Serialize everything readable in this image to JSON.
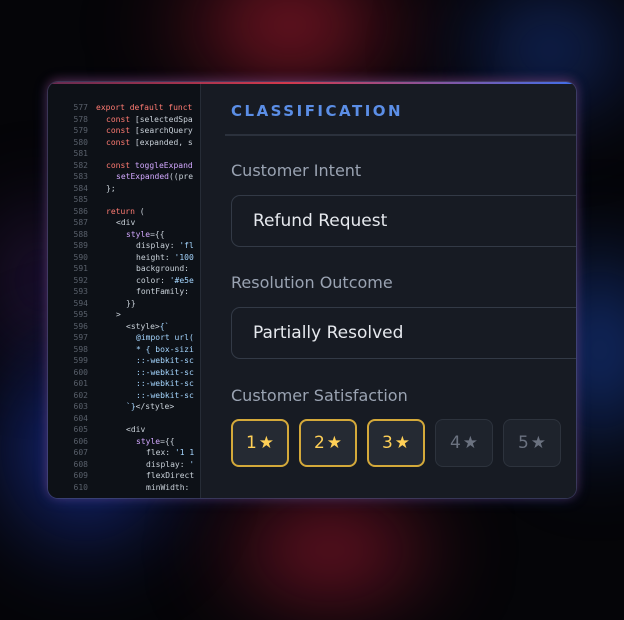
{
  "code_editor": {
    "lines": [
      {
        "n": "577",
        "indent": 0,
        "tokens": [
          {
            "t": "export default funct",
            "c": "kw"
          }
        ]
      },
      {
        "n": "578",
        "indent": 1,
        "tokens": [
          {
            "t": "const ",
            "c": "kw"
          },
          {
            "t": "[selectedSpa",
            "c": "plain"
          }
        ]
      },
      {
        "n": "579",
        "indent": 1,
        "tokens": [
          {
            "t": "const ",
            "c": "kw"
          },
          {
            "t": "[searchQuery",
            "c": "plain"
          }
        ]
      },
      {
        "n": "580",
        "indent": 1,
        "tokens": [
          {
            "t": "const ",
            "c": "kw"
          },
          {
            "t": "[expanded, s",
            "c": "plain"
          }
        ]
      },
      {
        "n": "581",
        "indent": 0,
        "tokens": []
      },
      {
        "n": "582",
        "indent": 1,
        "tokens": [
          {
            "t": "const ",
            "c": "kw"
          },
          {
            "t": "toggleExpand",
            "c": "fn"
          }
        ]
      },
      {
        "n": "583",
        "indent": 2,
        "tokens": [
          {
            "t": "setExpanded",
            "c": "fn"
          },
          {
            "t": "((pre",
            "c": "plain"
          }
        ]
      },
      {
        "n": "584",
        "indent": 1,
        "tokens": [
          {
            "t": "};",
            "c": "plain"
          }
        ]
      },
      {
        "n": "585",
        "indent": 0,
        "tokens": []
      },
      {
        "n": "586",
        "indent": 1,
        "tokens": [
          {
            "t": "return ",
            "c": "kw"
          },
          {
            "t": "(",
            "c": "plain"
          }
        ]
      },
      {
        "n": "587",
        "indent": 2,
        "tokens": [
          {
            "t": "<div",
            "c": "plain"
          }
        ]
      },
      {
        "n": "588",
        "indent": 3,
        "tokens": [
          {
            "t": "style",
            "c": "fn"
          },
          {
            "t": "={{",
            "c": "plain"
          }
        ]
      },
      {
        "n": "589",
        "indent": 4,
        "tokens": [
          {
            "t": "display: ",
            "c": "plain"
          },
          {
            "t": "'fl",
            "c": "str"
          }
        ]
      },
      {
        "n": "590",
        "indent": 4,
        "tokens": [
          {
            "t": "height: ",
            "c": "plain"
          },
          {
            "t": "'100",
            "c": "str"
          }
        ]
      },
      {
        "n": "591",
        "indent": 4,
        "tokens": [
          {
            "t": "background:",
            "c": "plain"
          }
        ]
      },
      {
        "n": "592",
        "indent": 4,
        "tokens": [
          {
            "t": "color: ",
            "c": "plain"
          },
          {
            "t": "'#e5e",
            "c": "str"
          }
        ]
      },
      {
        "n": "593",
        "indent": 4,
        "tokens": [
          {
            "t": "fontFamily:",
            "c": "plain"
          }
        ]
      },
      {
        "n": "594",
        "indent": 3,
        "tokens": [
          {
            "t": "}}",
            "c": "plain"
          }
        ]
      },
      {
        "n": "595",
        "indent": 2,
        "tokens": [
          {
            "t": ">",
            "c": "plain"
          }
        ]
      },
      {
        "n": "596",
        "indent": 3,
        "tokens": [
          {
            "t": "<style>",
            "c": "plain"
          },
          {
            "t": "{`",
            "c": "str"
          }
        ]
      },
      {
        "n": "597",
        "indent": 4,
        "tokens": [
          {
            "t": "@import url(",
            "c": "str"
          }
        ]
      },
      {
        "n": "598",
        "indent": 4,
        "tokens": [
          {
            "t": "* { box-sizi",
            "c": "str"
          }
        ]
      },
      {
        "n": "599",
        "indent": 4,
        "tokens": [
          {
            "t": "::-webkit-sc",
            "c": "str"
          }
        ]
      },
      {
        "n": "600",
        "indent": 4,
        "tokens": [
          {
            "t": "::-webkit-sc",
            "c": "str"
          }
        ]
      },
      {
        "n": "601",
        "indent": 4,
        "tokens": [
          {
            "t": "::-webkit-sc",
            "c": "str"
          }
        ]
      },
      {
        "n": "602",
        "indent": 4,
        "tokens": [
          {
            "t": "::-webkit-sc",
            "c": "str"
          }
        ]
      },
      {
        "n": "603",
        "indent": 3,
        "tokens": [
          {
            "t": "`}",
            "c": "str"
          },
          {
            "t": "</style>",
            "c": "plain"
          }
        ]
      },
      {
        "n": "604",
        "indent": 0,
        "tokens": []
      },
      {
        "n": "605",
        "indent": 3,
        "tokens": [
          {
            "t": "<div",
            "c": "plain"
          }
        ]
      },
      {
        "n": "606",
        "indent": 4,
        "tokens": [
          {
            "t": "style",
            "c": "fn"
          },
          {
            "t": "={{",
            "c": "plain"
          }
        ]
      },
      {
        "n": "607",
        "indent": 5,
        "tokens": [
          {
            "t": "flex: ",
            "c": "plain"
          },
          {
            "t": "'1 1",
            "c": "str"
          }
        ]
      },
      {
        "n": "608",
        "indent": 5,
        "tokens": [
          {
            "t": "display: ",
            "c": "plain"
          },
          {
            "t": "'",
            "c": "str"
          }
        ]
      },
      {
        "n": "609",
        "indent": 5,
        "tokens": [
          {
            "t": "flexDirect",
            "c": "plain"
          }
        ]
      },
      {
        "n": "610",
        "indent": 5,
        "tokens": [
          {
            "t": "minWidth:",
            "c": "plain"
          }
        ]
      }
    ]
  },
  "classification": {
    "title": "CLASSIFICATION",
    "intent": {
      "label": "Customer Intent",
      "value": "Refund Request"
    },
    "resolution": {
      "label": "Resolution Outcome",
      "value": "Partially Resolved"
    },
    "satisfaction": {
      "label": "Customer Satisfaction",
      "options": [
        "1",
        "2",
        "3",
        "4",
        "5"
      ],
      "selected": 3
    }
  },
  "colors": {
    "accent": "#5b8ee6",
    "star_active": "#ffd057",
    "star_border_active": "#d4a93a",
    "star_inactive": "#6b7280"
  },
  "icons": {
    "rating": "star-icon"
  }
}
